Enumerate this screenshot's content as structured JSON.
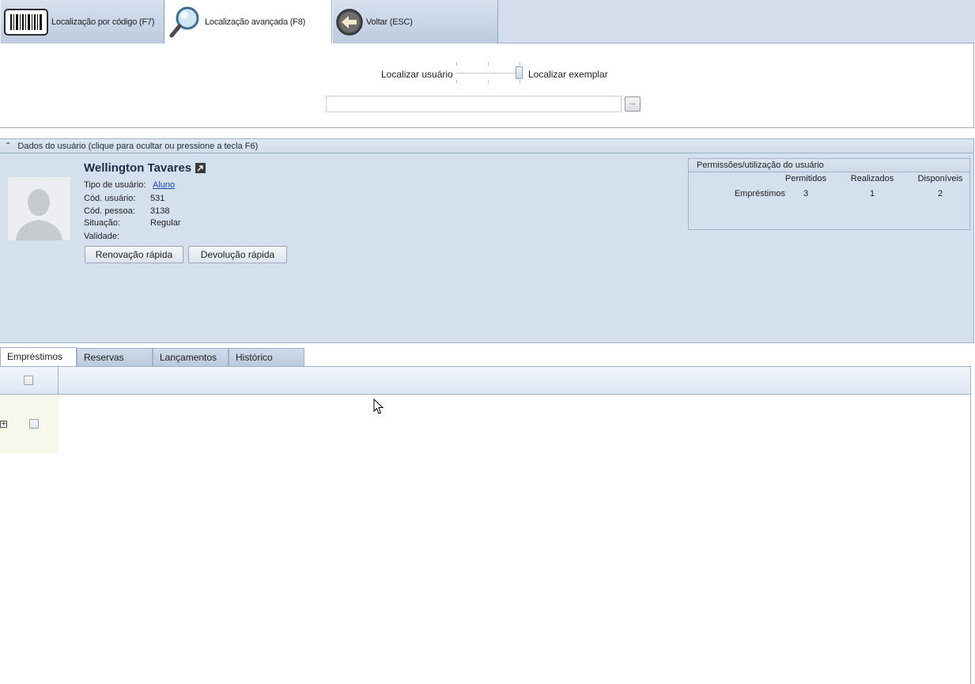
{
  "toolbar": {
    "tabs": [
      {
        "label": "Localização por código (F7)",
        "icon": "barcode-icon",
        "active": false
      },
      {
        "label": "Localização avançada (F8)",
        "icon": "magnifier-icon",
        "active": true
      },
      {
        "label": "Voltar (ESC)",
        "icon": "back-arrow-icon",
        "active": false
      }
    ]
  },
  "search": {
    "mode_user_label": "Localizar usuário",
    "mode_item_label": "Localizar exemplar",
    "selected_mode": "Localizar exemplar",
    "input_value": "",
    "browse_label": "..."
  },
  "user_panel": {
    "header": "Dados do usuário (clique para ocultar ou pressione a tecla F6)",
    "name": "Wellington Tavares",
    "fields": {
      "type_label": "Tipo de usuário:",
      "type_value": "Aluno",
      "code_label": "Cód. usuário:",
      "code_value": "531",
      "person_label": "Cód. pessoa:",
      "person_value": "3138",
      "status_label": "Situação:",
      "status_value": "Regular",
      "validity_label": "Validade:",
      "validity_value": ""
    },
    "buttons": {
      "renew": "Renovação rápida",
      "return": "Devolução rápida"
    },
    "permissions": {
      "title": "Permissões/utilização do usuário",
      "columns": [
        "Permitidos",
        "Realizados",
        "Disponíveis"
      ],
      "rows": [
        {
          "label": "Empréstimos",
          "values": [
            "3",
            "1",
            "2"
          ]
        }
      ]
    }
  },
  "bottom_tabs": [
    {
      "label": "Empréstimos",
      "active": true
    },
    {
      "label": "Reservas",
      "active": false
    },
    {
      "label": "Lançamentos",
      "active": false
    },
    {
      "label": "Histórico",
      "active": false
    }
  ],
  "colors": {
    "panel_bg": "#d5e0ee",
    "border": "#9fb2ca",
    "link": "#1b43b5",
    "row_selector_bg": "#f8f7ec"
  }
}
